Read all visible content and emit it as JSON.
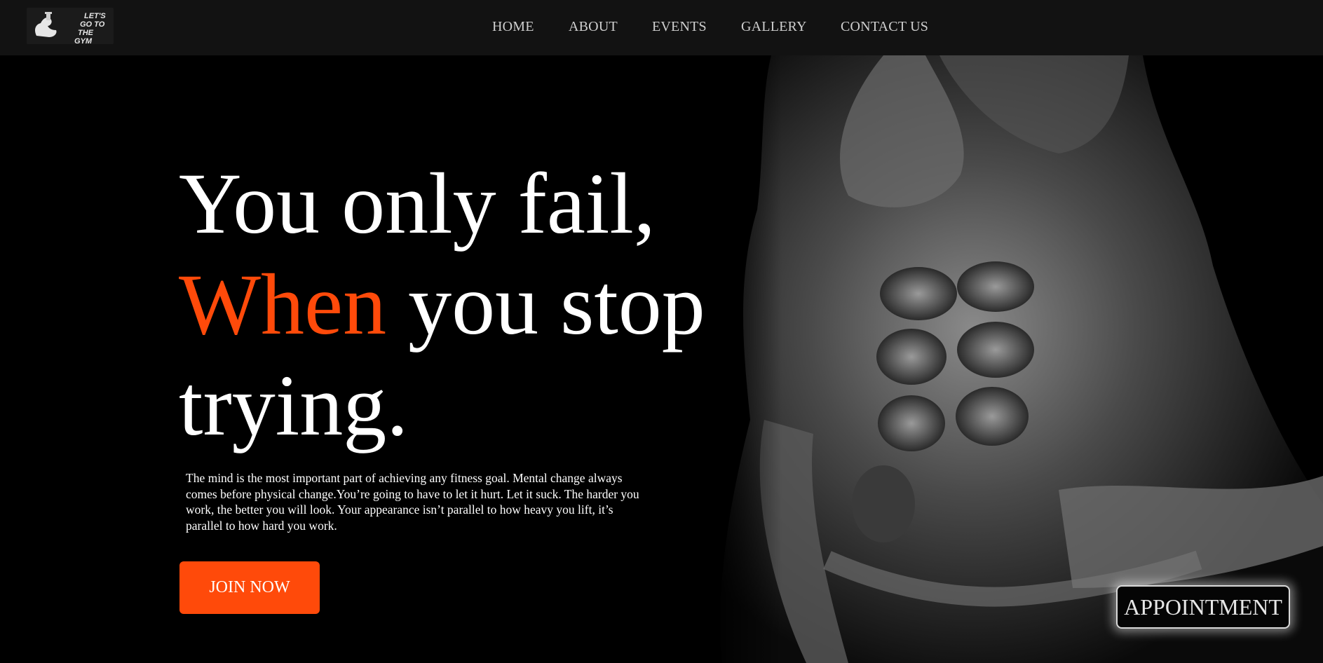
{
  "brand": {
    "logo_lines": [
      "LET'S",
      "GO TO",
      "THE",
      "GYM"
    ],
    "logo_icon": "flexed-arm-icon"
  },
  "nav": {
    "items": [
      "HOME",
      "ABOUT",
      "EVENTS",
      "GALLERY",
      "CONTACT US"
    ]
  },
  "hero": {
    "headline": {
      "line1": "You only fail,",
      "line2_accent": "When",
      "line2_rest": " you stop",
      "line3": "trying."
    },
    "description": "The mind is the most important part of achieving any fitness goal. Mental change always comes before physical change.You’re going to have to let it hurt. Let it suck. The harder you work, the better you will look. Your appearance isn’t parallel to how heavy you lift, it’s parallel to how hard you work.",
    "cta_label": "JOIN NOW",
    "image": "muscular-torso-photo"
  },
  "appointment": {
    "label": "APPOINTMENT"
  },
  "colors": {
    "accent": "#ff4a0a",
    "navbar_bg": "#121212",
    "page_bg": "#000000",
    "nav_text": "#cfcfcf"
  }
}
